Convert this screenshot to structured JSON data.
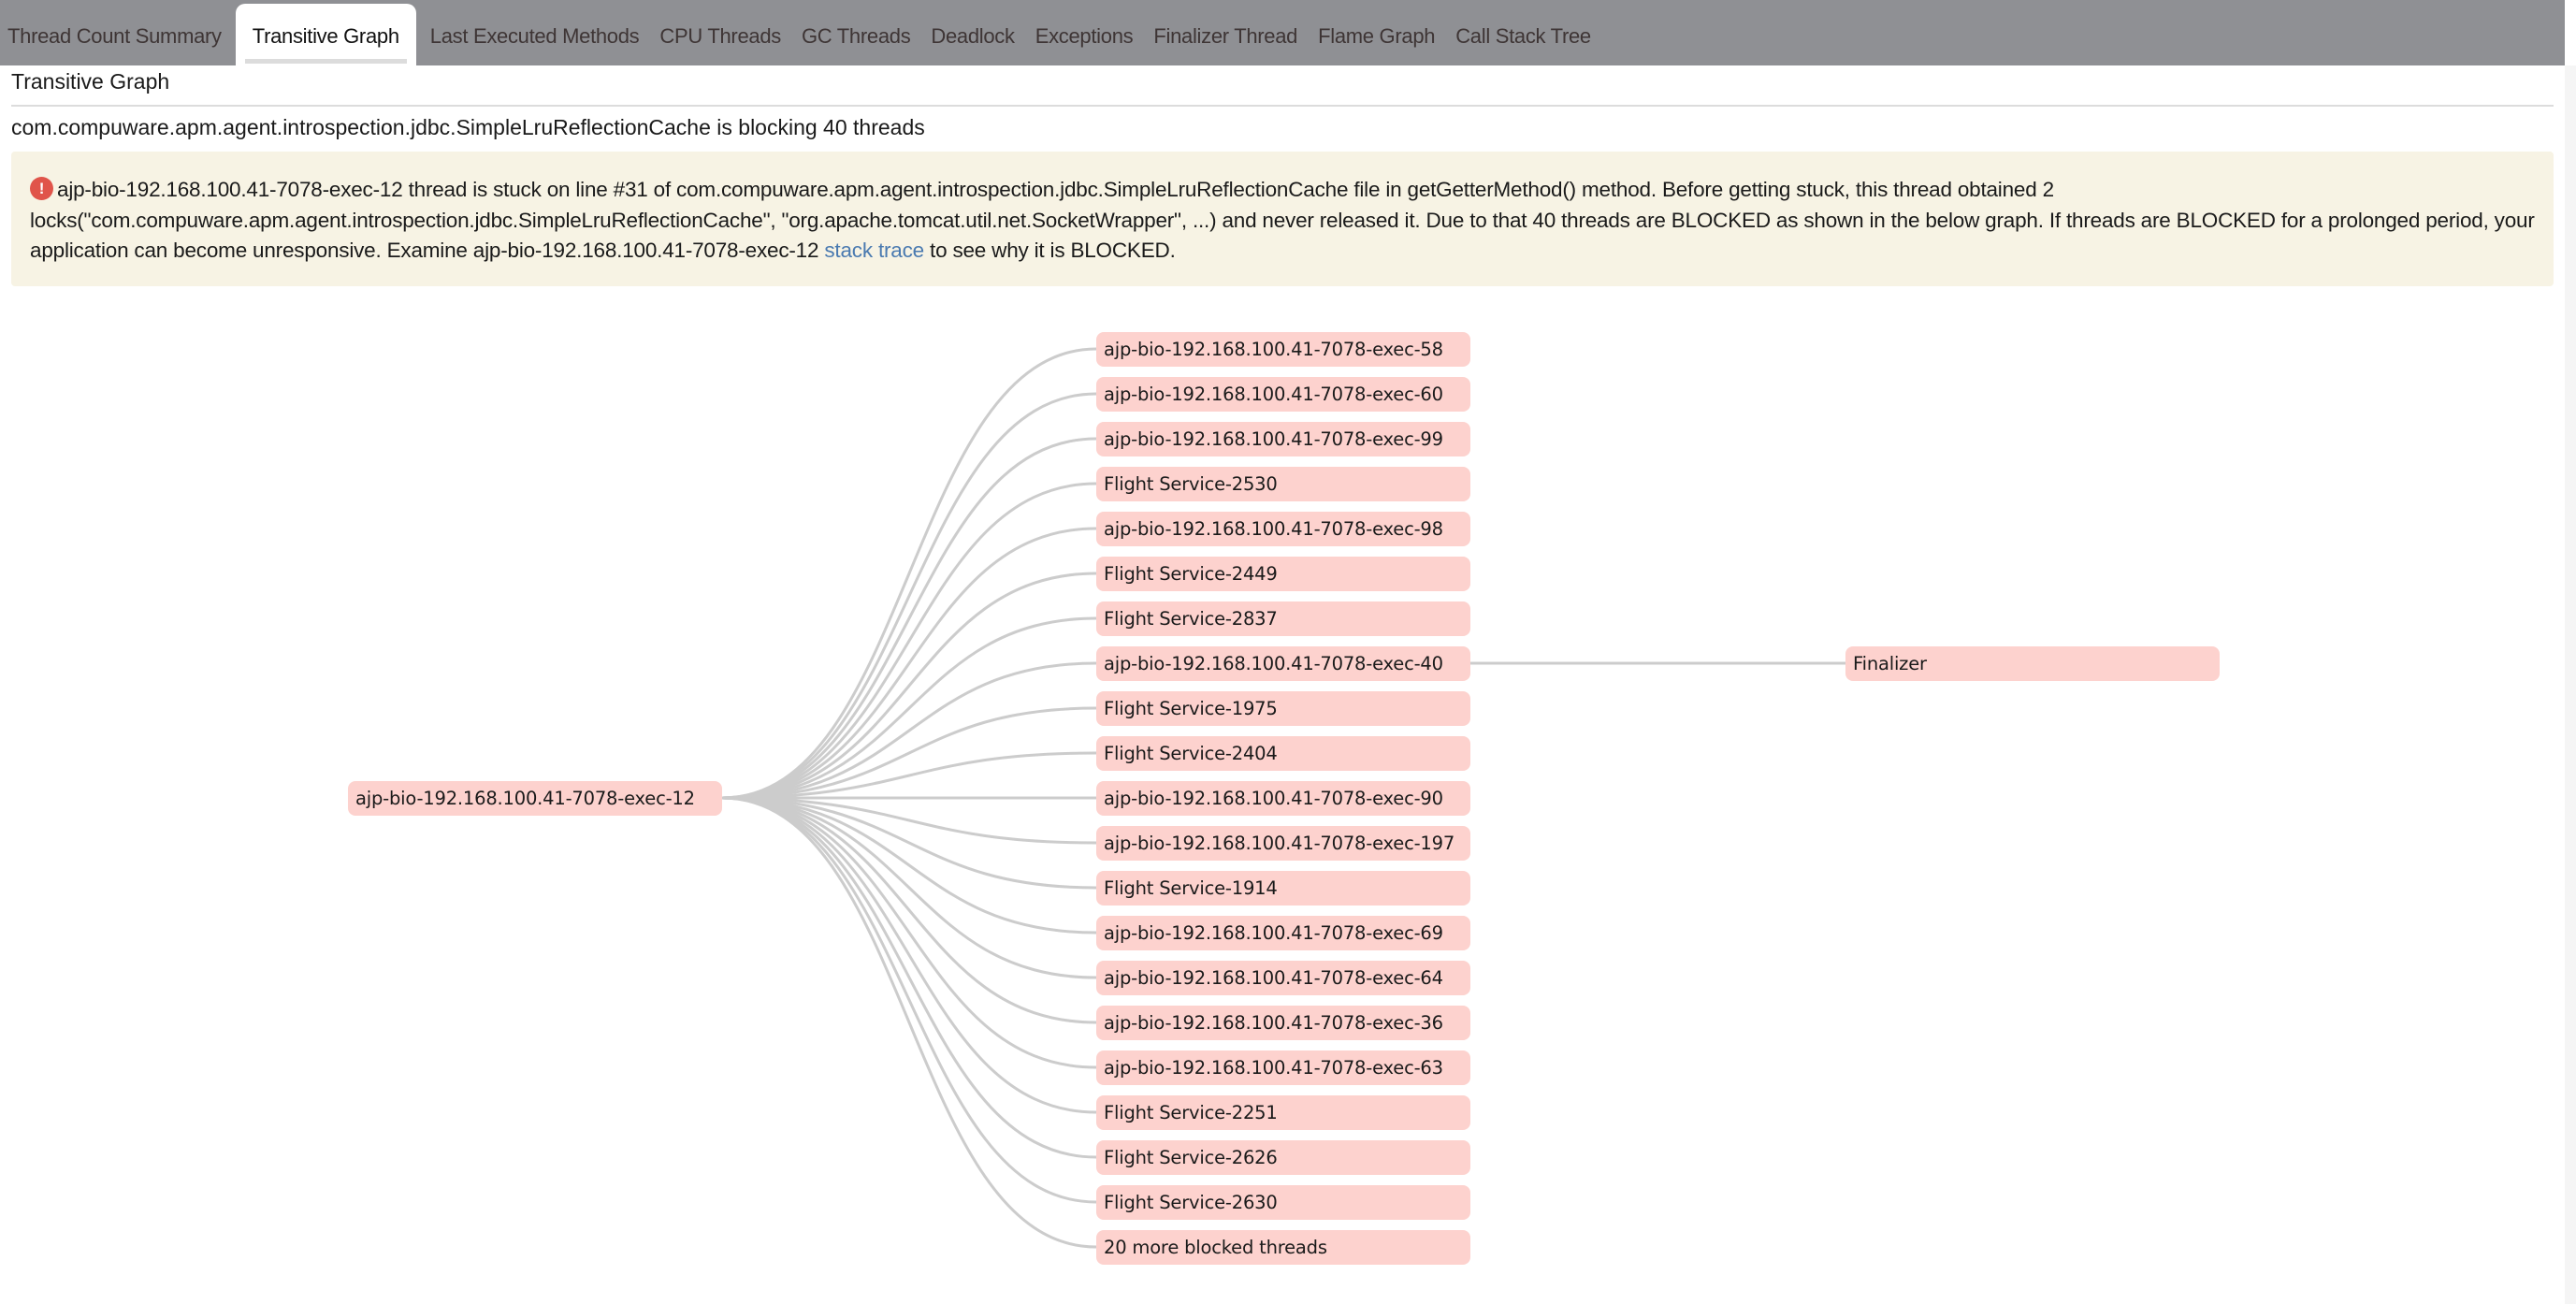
{
  "tabs": [
    {
      "label": "Thread Count Summary",
      "active": false
    },
    {
      "label": "Transitive Graph",
      "active": true
    },
    {
      "label": "Last Executed Methods",
      "active": false
    },
    {
      "label": "CPU Threads",
      "active": false
    },
    {
      "label": "GC Threads",
      "active": false
    },
    {
      "label": "Deadlock",
      "active": false
    },
    {
      "label": "Exceptions",
      "active": false
    },
    {
      "label": "Finalizer Thread",
      "active": false
    },
    {
      "label": "Flame Graph",
      "active": false
    },
    {
      "label": "Call Stack Tree",
      "active": false
    }
  ],
  "section": {
    "title": "Transitive Graph",
    "summary": "com.compuware.apm.agent.introspection.jdbc.SimpleLruReflectionCache is blocking 40 threads"
  },
  "alert": {
    "icon": "error-icon",
    "icon_glyph": "!",
    "text_before_link": "ajp-bio-192.168.100.41-7078-exec-12 thread is stuck on line #31 of com.compuware.apm.agent.introspection.jdbc.SimpleLruReflectionCache file in getGetterMethod() method. Before getting stuck, this thread obtained 2 locks(\"com.compuware.apm.agent.introspection.jdbc.SimpleLruReflectionCache\", \"org.apache.tomcat.util.net.SocketWrapper\", ...) and never released it. Due to that 40 threads are BLOCKED as shown in the below graph. If threads are BLOCKED for a prolonged period, your application can become unresponsive. Examine ajp-bio-192.168.100.41-7078-exec-12",
    "link_text": "stack trace",
    "text_after_link": "to see why it is BLOCKED.",
    "icon_color": "#e0544a",
    "link_color": "#4a7ab0"
  },
  "graph": {
    "node_color": "#fdd2ce",
    "edge_color": "#cccccc",
    "root": "ajp-bio-192.168.100.41-7078-exec-12",
    "blocked_threads": [
      "ajp-bio-192.168.100.41-7078-exec-58",
      "ajp-bio-192.168.100.41-7078-exec-60",
      "ajp-bio-192.168.100.41-7078-exec-99",
      "Flight Service-2530",
      "ajp-bio-192.168.100.41-7078-exec-98",
      "Flight Service-2449",
      "Flight Service-2837",
      "ajp-bio-192.168.100.41-7078-exec-40",
      "Flight Service-1975",
      "Flight Service-2404",
      "ajp-bio-192.168.100.41-7078-exec-90",
      "ajp-bio-192.168.100.41-7078-exec-197",
      "Flight Service-1914",
      "ajp-bio-192.168.100.41-7078-exec-69",
      "ajp-bio-192.168.100.41-7078-exec-64",
      "ajp-bio-192.168.100.41-7078-exec-36",
      "ajp-bio-192.168.100.41-7078-exec-63",
      "Flight Service-2251",
      "Flight Service-2626",
      "Flight Service-2630",
      "20 more blocked threads"
    ],
    "second_level": [
      {
        "parent": "ajp-bio-192.168.100.41-7078-exec-40",
        "child": "Finalizer"
      }
    ]
  }
}
